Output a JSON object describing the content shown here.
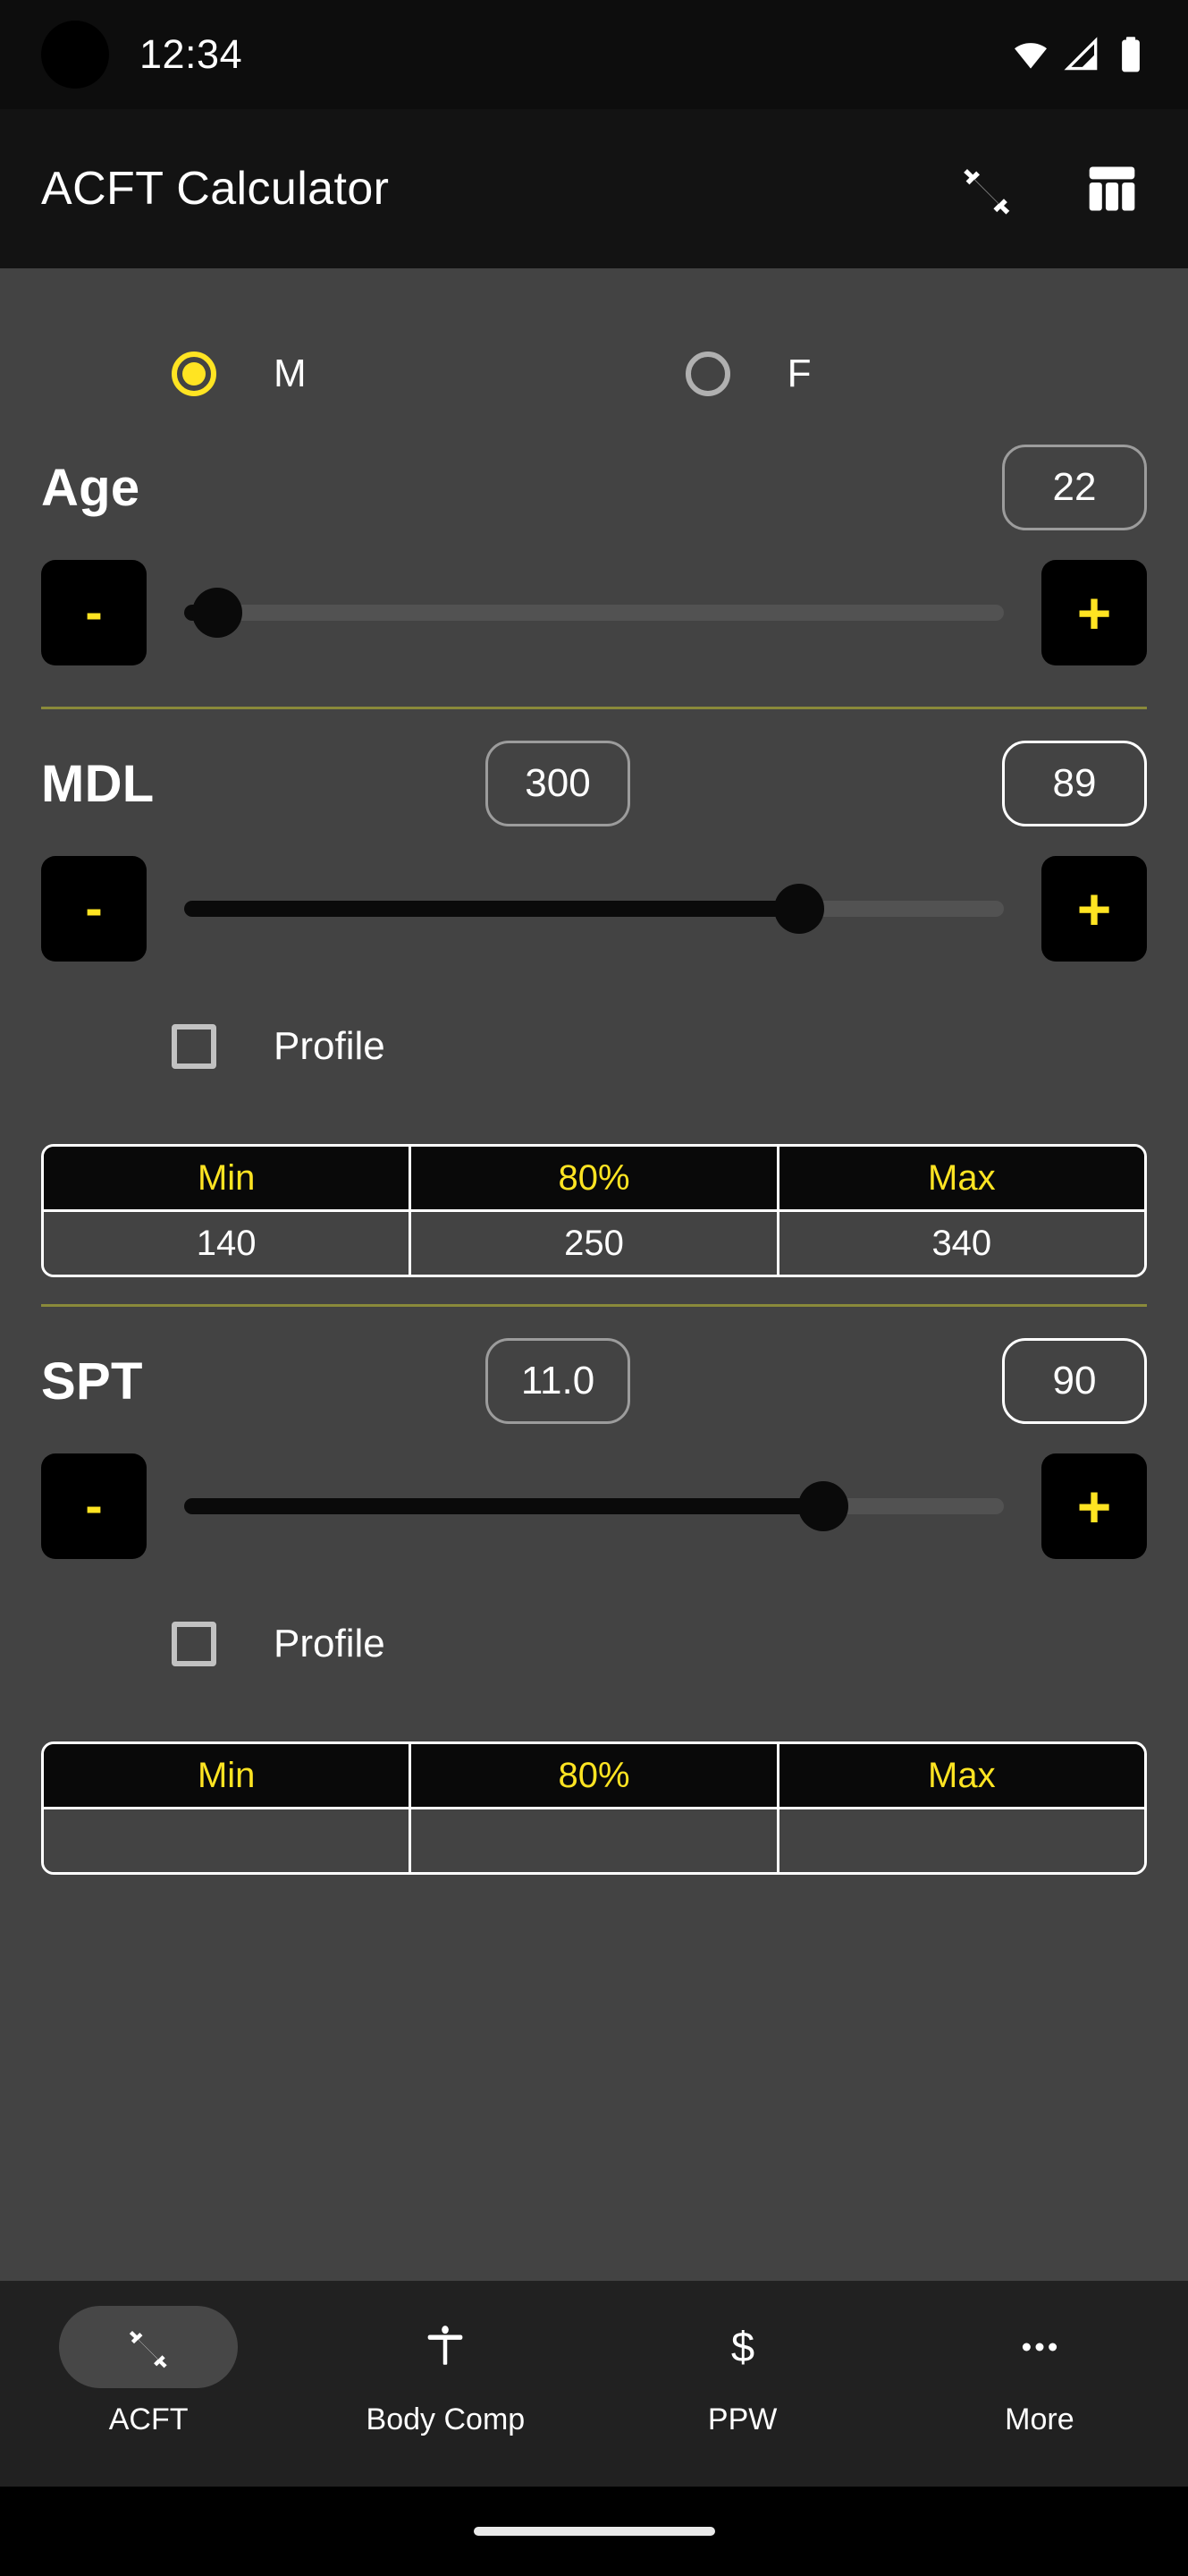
{
  "status_bar": {
    "time": "12:34",
    "icons": [
      "wifi-icon",
      "cellular-signal-icon",
      "battery-icon"
    ]
  },
  "app_bar": {
    "title": "ACFT Calculator",
    "actions": [
      {
        "name": "dumbbell-icon",
        "label": "Workout"
      },
      {
        "name": "table-icon",
        "label": "Score Table"
      }
    ]
  },
  "gender": {
    "options": [
      {
        "label": "M",
        "selected": true
      },
      {
        "label": "F",
        "selected": false
      }
    ]
  },
  "colors": {
    "accent_yellow": "#ffe422",
    "divider_olive": "#8a8a3a",
    "screen_bg": "#434343",
    "appbar_bg": "#131313",
    "navbar_bg": "#212121",
    "button_black": "#000000"
  },
  "sections": [
    {
      "id": "age",
      "title": "Age",
      "mid_value": null,
      "right_value": "22",
      "right_is_score": false,
      "minus_label": "-",
      "plus_label": "+",
      "slider_percent": 4,
      "has_profile": false,
      "has_table": false
    },
    {
      "id": "mdl",
      "title": "MDL",
      "mid_value": "300",
      "right_value": "89",
      "right_is_score": true,
      "minus_label": "-",
      "plus_label": "+",
      "slider_percent": 75,
      "has_profile": true,
      "profile_label": "Profile",
      "profile_checked": false,
      "has_table": true,
      "table": {
        "headers": [
          "Min",
          "80%",
          "Max"
        ],
        "values": [
          "140",
          "250",
          "340"
        ]
      }
    },
    {
      "id": "spt",
      "title": "SPT",
      "mid_value": "11.0",
      "right_value": "90",
      "right_is_score": true,
      "minus_label": "-",
      "plus_label": "+",
      "slider_percent": 78,
      "has_profile": true,
      "profile_label": "Profile",
      "profile_checked": false,
      "has_table": true,
      "table": {
        "headers": [
          "Min",
          "80%",
          "Max"
        ],
        "values": [
          "",
          "",
          ""
        ]
      }
    }
  ],
  "bottom_nav": {
    "items": [
      {
        "label": "ACFT",
        "icon": "dumbbell-icon",
        "active": true
      },
      {
        "label": "Body Comp",
        "icon": "person-icon",
        "active": false
      },
      {
        "label": "PPW",
        "icon": "dollar-icon",
        "active": false
      },
      {
        "label": "More",
        "icon": "more-dots-icon",
        "active": false
      }
    ]
  }
}
